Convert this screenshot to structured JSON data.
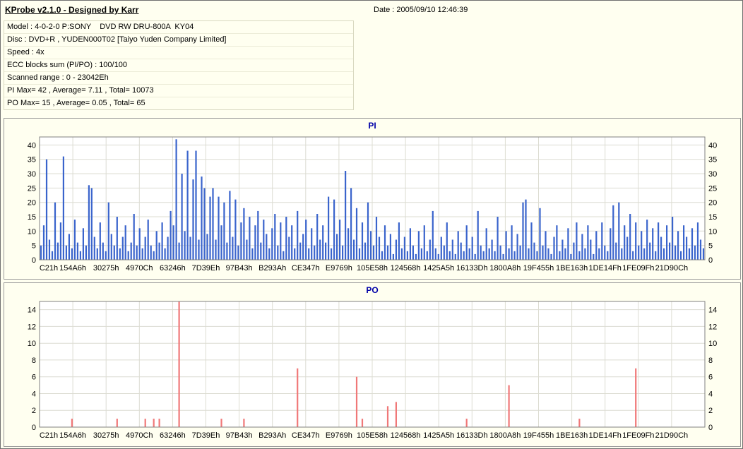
{
  "window": {
    "app_title": "KProbe v2.1.0 - Designed by Karr",
    "date_label": "Date : 2005/09/10 12:46:39"
  },
  "info": {
    "rows": [
      "Model : 4-0-2-0 P:SONY    DVD RW DRU-800A  KY04",
      "Disc : DVD+R , YUDEN000T02 [Taiyo Yuden Company Limited]",
      "Speed : 4x",
      "ECC blocks sum (PI/PO) : 100/100",
      "Scanned range : 0 - 23042Eh",
      "PI Max= 42 , Average= 7.11 , Total= 10073",
      "PO Max= 15 , Average= 0.05 , Total= 65"
    ]
  },
  "chart_data": [
    {
      "type": "bar",
      "title": "PI",
      "color": "#3a64cc",
      "ylim": [
        0,
        40
      ],
      "y_ticks": [
        0,
        5,
        10,
        15,
        20,
        25,
        30,
        35,
        40
      ],
      "x_tick_labels": [
        "C21h",
        "154A6h",
        "30275h",
        "4970Ch",
        "63246h",
        "7D39Eh",
        "97B43h",
        "B293Ah",
        "CE347h",
        "E9769h",
        "105E58h",
        "124568h",
        "1425A5h",
        "16133Dh",
        "1800A8h",
        "19F455h",
        "1BE163h",
        "1DE14Fh",
        "1FE09Fh",
        "21D90Ch"
      ],
      "stats": {
        "max": 42,
        "average": 7.11,
        "total": 10073
      },
      "values": [
        5,
        12,
        35,
        7,
        3,
        20,
        6,
        13,
        36,
        5,
        9,
        4,
        14,
        6,
        3,
        11,
        5,
        26,
        25,
        8,
        4,
        13,
        6,
        3,
        20,
        9,
        5,
        15,
        4,
        8,
        12,
        3,
        6,
        16,
        5,
        11,
        4,
        8,
        14,
        5,
        3,
        10,
        6,
        13,
        4,
        8,
        17,
        12,
        42,
        6,
        30,
        10,
        38,
        8,
        28,
        38,
        7,
        29,
        25,
        9,
        22,
        25,
        7,
        22,
        12,
        20,
        6,
        24,
        8,
        21,
        5,
        13,
        18,
        7,
        15,
        4,
        12,
        17,
        6,
        14,
        9,
        4,
        11,
        16,
        5,
        13,
        3,
        15,
        8,
        12,
        4,
        17,
        6,
        9,
        14,
        4,
        11,
        5,
        16,
        7,
        12,
        6,
        22,
        4,
        21,
        9,
        14,
        5,
        31,
        11,
        25,
        7,
        18,
        4,
        13,
        6,
        20,
        10,
        5,
        15,
        8,
        3,
        12,
        5,
        9,
        2,
        7,
        13,
        4,
        8,
        3,
        11,
        5,
        2,
        10,
        4,
        12,
        3,
        7,
        17,
        4,
        2,
        8,
        5,
        13,
        3,
        7,
        2,
        10,
        6,
        3,
        12,
        4,
        8,
        2,
        17,
        5,
        3,
        11,
        4,
        7,
        3,
        15,
        5,
        2,
        10,
        4,
        12,
        3,
        9,
        5,
        20,
        21,
        4,
        13,
        6,
        3,
        18,
        5,
        10,
        4,
        2,
        8,
        12,
        3,
        7,
        4,
        11,
        2,
        6,
        13,
        3,
        9,
        4,
        12,
        7,
        2,
        10,
        4,
        13,
        5,
        3,
        11,
        19,
        6,
        20,
        4,
        12,
        8,
        16,
        3,
        13,
        5,
        10,
        4,
        14,
        6,
        11,
        3,
        13,
        8,
        4,
        12,
        6,
        15,
        5,
        10,
        3,
        12,
        8,
        4,
        11,
        5,
        13,
        7,
        4
      ]
    },
    {
      "type": "bar",
      "title": "PO",
      "color": "#f07878",
      "ylim": [
        0,
        14
      ],
      "y_ticks": [
        0,
        2,
        4,
        6,
        8,
        10,
        12,
        14
      ],
      "x_tick_labels": [
        "C21h",
        "154A6h",
        "30275h",
        "4970Ch",
        "63246h",
        "7D39Eh",
        "97B43h",
        "B293Ah",
        "CE347h",
        "E9769h",
        "105E58h",
        "124568h",
        "1425A5h",
        "16133Dh",
        "1800A8h",
        "19F455h",
        "1BE163h",
        "1DE14Fh",
        "1FE09Fh",
        "21D90Ch"
      ],
      "stats": {
        "max": 15,
        "average": 0.05,
        "total": 65
      },
      "n_points": 236,
      "spikes": [
        {
          "i": 11,
          "v": 1
        },
        {
          "i": 27,
          "v": 1
        },
        {
          "i": 37,
          "v": 1
        },
        {
          "i": 40,
          "v": 1
        },
        {
          "i": 42,
          "v": 1
        },
        {
          "i": 49,
          "v": 15
        },
        {
          "i": 64,
          "v": 1
        },
        {
          "i": 72,
          "v": 1
        },
        {
          "i": 91,
          "v": 7
        },
        {
          "i": 112,
          "v": 6
        },
        {
          "i": 114,
          "v": 1
        },
        {
          "i": 123,
          "v": 2.5
        },
        {
          "i": 126,
          "v": 3
        },
        {
          "i": 151,
          "v": 1
        },
        {
          "i": 166,
          "v": 5
        },
        {
          "i": 191,
          "v": 1
        },
        {
          "i": 211,
          "v": 7
        }
      ]
    }
  ]
}
